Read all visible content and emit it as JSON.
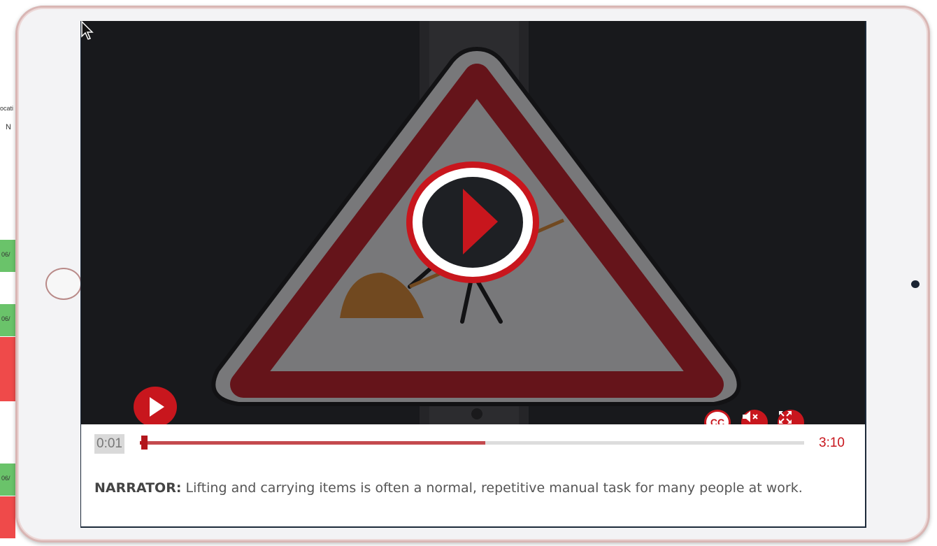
{
  "background_app": {
    "label_top": "ocati",
    "label_second": "N",
    "rows": [
      {
        "text": "06/",
        "color": "#6ac36a"
      },
      {
        "text": "06/",
        "color": "#6ac36a"
      },
      {
        "text": "",
        "color": "#ef4a4a"
      },
      {
        "text": "",
        "color": "#ef4a4a"
      },
      {
        "text": "06/",
        "color": "#6ac36a"
      },
      {
        "text": "",
        "color": "#ef4a4a"
      }
    ]
  },
  "player": {
    "current_time": "0:01",
    "total_time": "3:10",
    "progress_fraction": 0.0016,
    "buffered_fraction": 0.52,
    "cc_label": "CC",
    "accent_color": "#c8161d",
    "icons": {
      "big_play": "play-circle-icon",
      "small_play": "play-icon",
      "cc": "closed-captions-icon",
      "mute": "volume-muted-icon",
      "fullscreen": "fullscreen-icon"
    }
  },
  "caption": {
    "speaker": "NARRATOR:",
    "text": " Lifting and carrying items is often a normal, repetitive manual task for many people at work."
  }
}
